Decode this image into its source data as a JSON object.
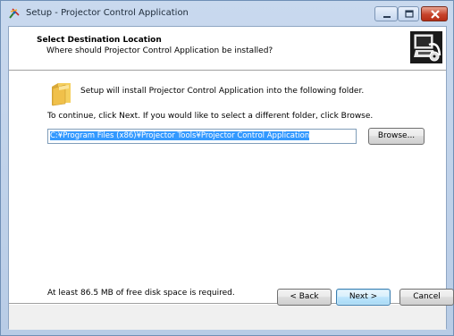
{
  "window": {
    "title": "Setup - Projector Control Application",
    "icon": "setup-app-icon"
  },
  "title_controls": {
    "minimize_icon": "minimize-icon",
    "maximize_icon": "maximize-icon",
    "close_icon": "close-icon"
  },
  "header": {
    "title": "Select Destination Location",
    "subtitle": "Where should Projector Control Application be installed?",
    "image": "computer-install-icon"
  },
  "body": {
    "folder_icon": "folder-icon",
    "folder_text": "Setup will install Projector Control Application into the following folder.",
    "continue_text": "To continue, click Next. If you would like to select a different folder, click Browse.",
    "path_value": "C:¥Program Files (x86)¥Projector Tools¥Projector Control Application",
    "browse_label": "Browse...",
    "space_text": "At least 86.5 MB of free disk space is required."
  },
  "footer": {
    "back_label": "< Back",
    "next_label": "Next >",
    "cancel_label": "Cancel"
  },
  "colors": {
    "selection": "#3399ff",
    "close_button": "#c7442c",
    "frame": "#b8cce6"
  }
}
